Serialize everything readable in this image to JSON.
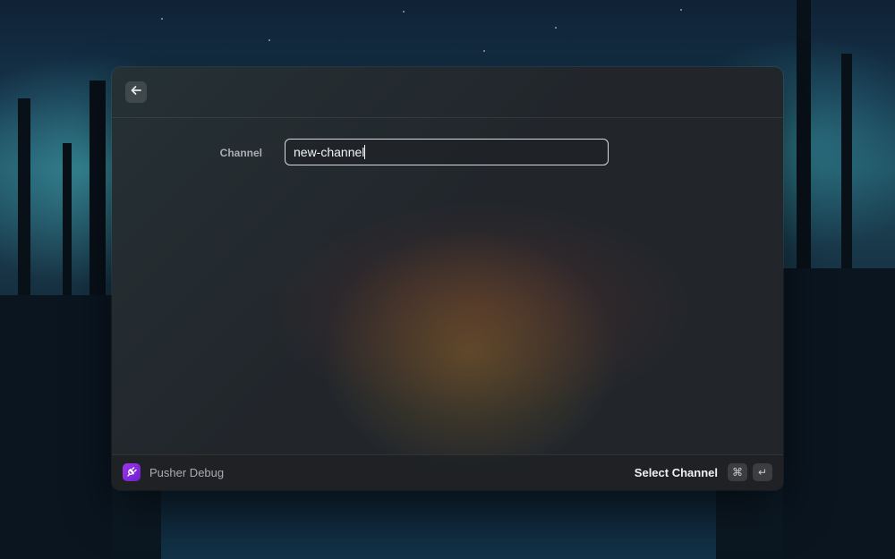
{
  "topbar": {
    "back_icon": "arrow-left-icon"
  },
  "form": {
    "channel_label": "Channel",
    "channel_value": "new-channel"
  },
  "footer": {
    "app_icon": "plug-icon",
    "app_name": "Pusher Debug",
    "primary_action": "Select Channel",
    "shortcut_cmd": "⌘",
    "shortcut_enter": "↵"
  },
  "colors": {
    "app_icon_accent": "#8a2be2",
    "input_border": "#d7d9dc",
    "window_bg": "#22262b"
  }
}
